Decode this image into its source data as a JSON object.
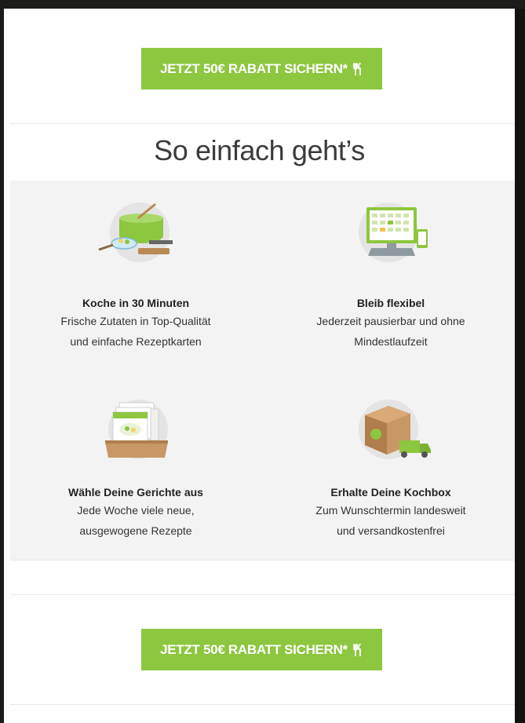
{
  "cta": {
    "label": "JETZT 50€ RABATT SICHERN*",
    "icon": "fork-knife-icon",
    "color": "#8dc63f"
  },
  "headline": "So einfach geht’s",
  "steps": [
    {
      "title": "Koche in 30 Minuten",
      "line1": "Frische Zutaten in Top-Qualität",
      "line2": "und einfache Rezeptkarten",
      "icon": "cooking-pot-icon"
    },
    {
      "title": "Bleib flexibel",
      "line1": "Jederzeit pausierbar und ohne",
      "line2": "Mindestlaufzeit",
      "icon": "computer-calendar-icon"
    },
    {
      "title": "Wähle Deine Gerichte aus",
      "line1": "Jede Woche viele neue,",
      "line2": "ausgewogene Rezepte",
      "icon": "recipe-cards-icon"
    },
    {
      "title": "Erhalte Deine Kochbox",
      "line1": "Zum Wunschtermin landesweit",
      "line2": "und versandkostenfrei",
      "icon": "delivery-box-icon"
    }
  ]
}
